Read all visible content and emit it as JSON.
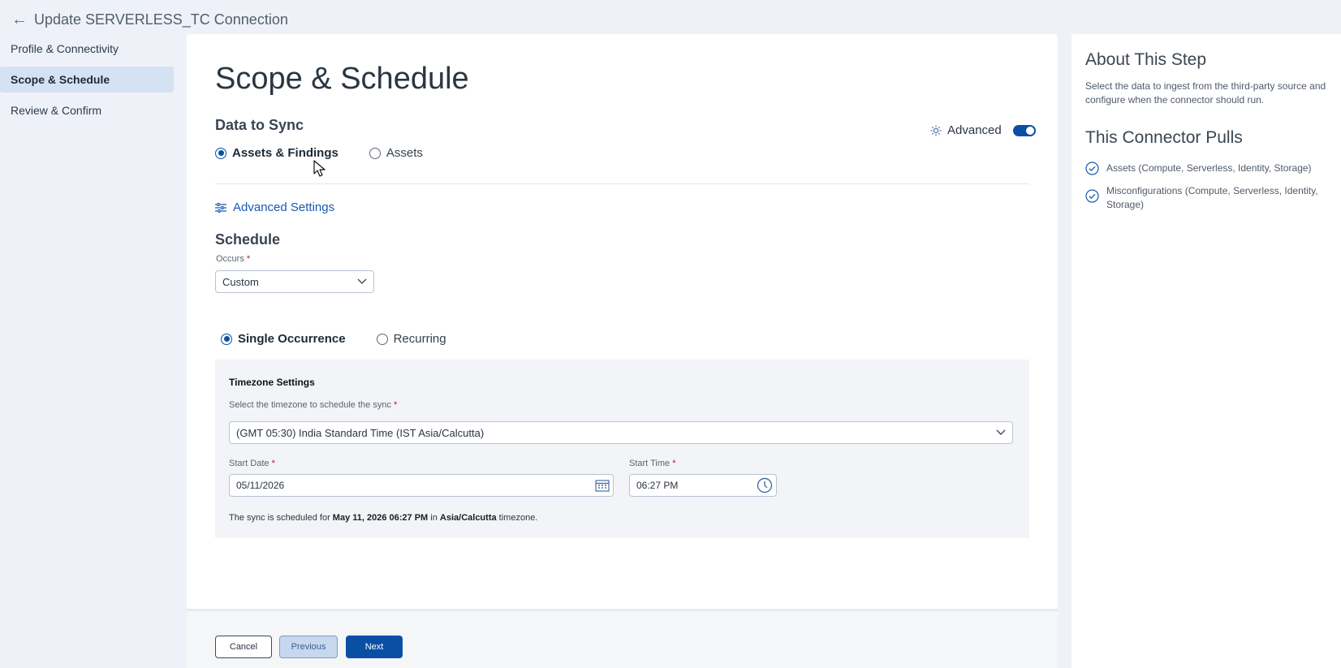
{
  "header": {
    "back_icon": "arrow-left-icon",
    "title": "Update SERVERLESS_TC Connection"
  },
  "nav": {
    "items": [
      {
        "label": "Profile & Connectivity",
        "active": false
      },
      {
        "label": "Scope & Schedule",
        "active": true
      },
      {
        "label": "Review & Confirm",
        "active": false
      }
    ]
  },
  "main": {
    "page_title": "Scope & Schedule",
    "data_to_sync": {
      "title": "Data to Sync",
      "advanced_label": "Advanced",
      "advanced_enabled": true,
      "options": [
        {
          "label": "Assets & Findings",
          "selected": true
        },
        {
          "label": "Assets",
          "selected": false
        }
      ]
    },
    "advanced_settings_link": "Advanced Settings",
    "schedule": {
      "title": "Schedule",
      "occurs_label": "Occurs",
      "occurs_value": "Custom",
      "occurrence_options": [
        {
          "label": "Single Occurrence",
          "selected": true
        },
        {
          "label": "Recurring",
          "selected": false
        }
      ]
    },
    "timezone": {
      "title": "Timezone Settings",
      "select_label": "Select the timezone to schedule the sync",
      "select_value": "(GMT 05:30) India Standard Time (IST Asia/Calcutta)",
      "start_date_label": "Start Date",
      "start_date_value": "05/11/2026",
      "start_time_label": "Start Time",
      "start_time_value": "06:27 PM",
      "summary_prefix": "The sync is scheduled for",
      "summary_datetime": "May 11, 2026 06:27 PM",
      "summary_in": "in",
      "summary_zone": "Asia/Calcutta",
      "summary_suffix": "timezone."
    },
    "required_marker": "*"
  },
  "footer": {
    "cancel_label": "Cancel",
    "previous_label": "Previous",
    "next_label": "Next"
  },
  "side": {
    "about_title": "About This Step",
    "about_text": "Select the data to ingest from the third-party source and configure when the connector should run.",
    "pulls_title": "This Connector Pulls",
    "pulls": [
      "Assets (Compute, Serverless, Identity, Storage)",
      "Misconfigurations (Compute, Serverless, Identity, Storage)"
    ]
  },
  "colors": {
    "accent": "#0b4fa5",
    "nav_active_bg": "#d4e2f3",
    "page_bg": "#eef2f8",
    "required": "#c8102e"
  }
}
